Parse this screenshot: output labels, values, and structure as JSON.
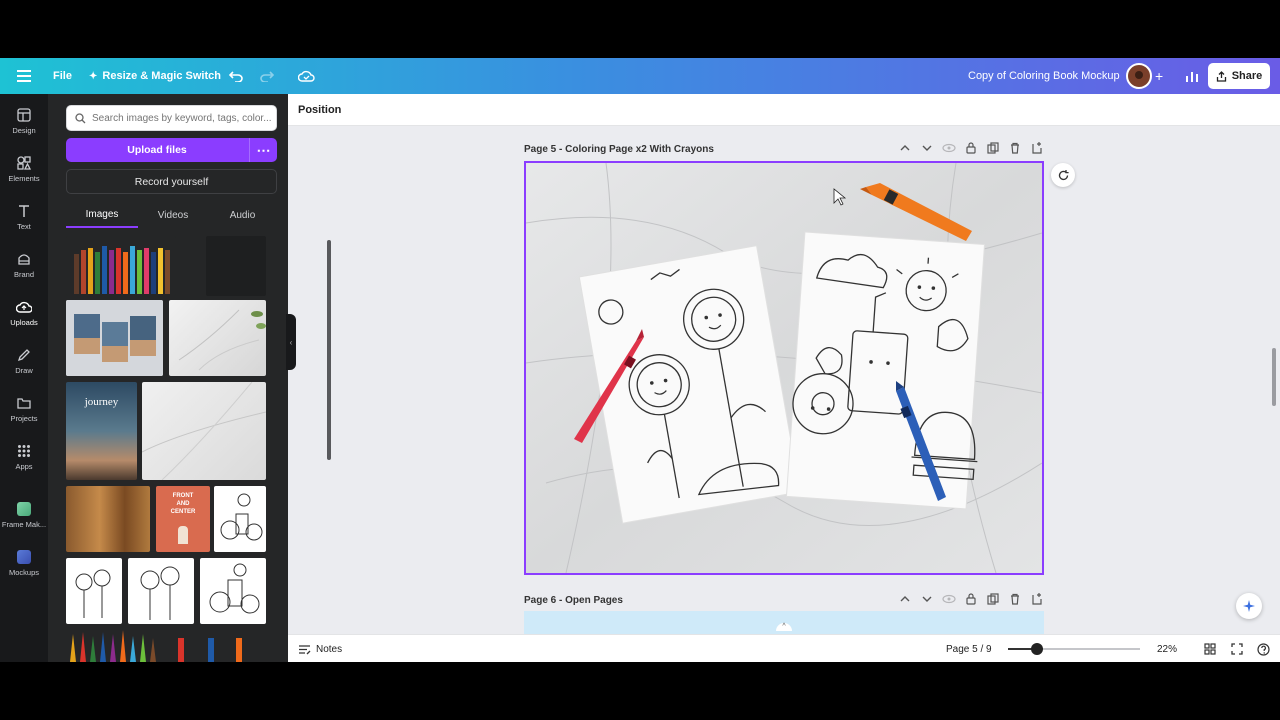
{
  "topbar": {
    "file": "File",
    "resize": "Resize & Magic Switch",
    "doc_title": "Copy of Coloring Book Mockup",
    "share": "Share",
    "gradient": [
      "#1ec2d4",
      "#6a5ce6"
    ]
  },
  "rail": [
    {
      "label": "Design",
      "icon": "layout-icon"
    },
    {
      "label": "Elements",
      "icon": "shapes-icon"
    },
    {
      "label": "Text",
      "icon": "text-icon"
    },
    {
      "label": "Brand",
      "icon": "brand-icon"
    },
    {
      "label": "Uploads",
      "icon": "cloud-upload-icon"
    },
    {
      "label": "Draw",
      "icon": "pen-icon"
    },
    {
      "label": "Projects",
      "icon": "folder-icon"
    },
    {
      "label": "Apps",
      "icon": "grid-icon"
    },
    {
      "label": "Frame Mak...",
      "icon": "frame-maker-icon"
    },
    {
      "label": "Mockups",
      "icon": "mockups-icon"
    }
  ],
  "panel": {
    "search_placeholder": "Search images by keyword, tags, color...",
    "upload": "Upload files",
    "more": "⋯",
    "record": "Record yourself",
    "tabs": [
      "Images",
      "Videos",
      "Audio"
    ],
    "active_tab": "Images",
    "accent": "#8b3dff"
  },
  "context": {
    "position": "Position"
  },
  "pages": {
    "page5_title": "Page 5 - Coloring Page x2 With Crayons",
    "page6_title": "Page 6 - Open Pages"
  },
  "bottom": {
    "notes": "Notes",
    "page_indicator": "Page 5 / 9",
    "zoom": "22%",
    "zoom_fraction": 0.22
  }
}
